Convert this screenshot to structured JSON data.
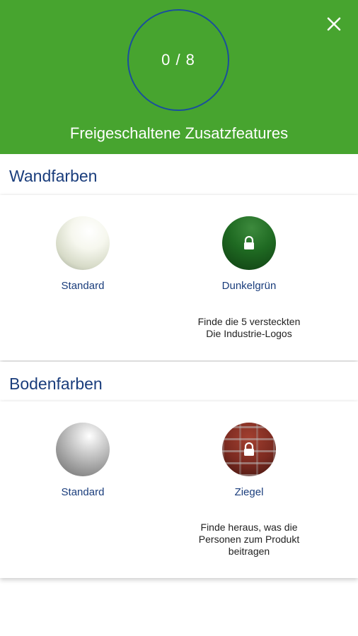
{
  "header": {
    "progress": "0 / 8",
    "title": "Freigeschaltene Zusatzfeatures"
  },
  "sections": [
    {
      "title": "Wandfarben",
      "items": [
        {
          "label": "Standard",
          "locked": false,
          "color": "#f3f5ea"
        },
        {
          "label": "Dunkelgrün",
          "locked": true,
          "color": "#1f6a22",
          "hint": "Finde die 5 versteckten\nDie Industrie-Logos"
        }
      ]
    },
    {
      "title": "Bodenfarben",
      "items": [
        {
          "label": "Standard",
          "locked": false,
          "color": "#b3b3b3"
        },
        {
          "label": "Ziegel",
          "locked": true,
          "color": "#7a2a20",
          "hint": "Finde heraus, was die\nPersonen zum Produkt\nbeitragen"
        }
      ]
    }
  ],
  "colors": {
    "header_bg": "#47a42f",
    "accent_blue": "#1a3d7c",
    "ring": "#1a4f9c"
  },
  "icons": {
    "close": "close-icon",
    "lock": "lock-icon"
  }
}
